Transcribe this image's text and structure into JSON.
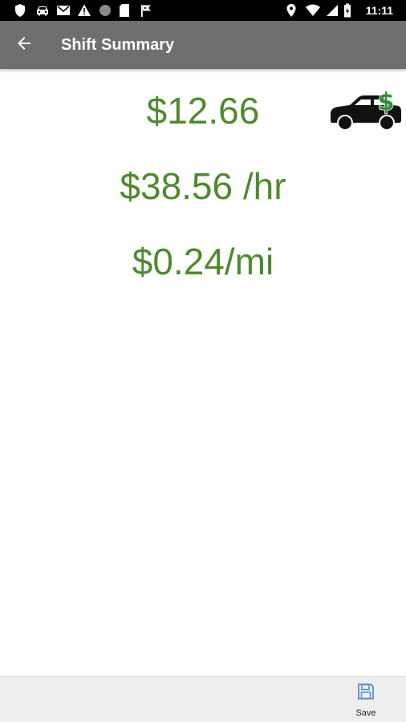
{
  "status_bar": {
    "time": "11:11",
    "left_icons": [
      "shield-icon",
      "car-icon",
      "gmail-icon",
      "warning-icon",
      "circle-icon",
      "sd-card-icon",
      "flag-icon"
    ],
    "right_icons": [
      "location-icon",
      "wifi-icon",
      "signal-icon",
      "battery-icon"
    ]
  },
  "app_bar": {
    "title": "Shift Summary",
    "back_icon": "arrow-back-icon",
    "background": "#6e6e6e"
  },
  "summary": {
    "total": "$12.66",
    "hourly": "$38.56 /hr",
    "per_mile": "$0.24/mi",
    "text_color": "#4e8a2e"
  },
  "bottom_bar": {
    "save_label": "Save",
    "save_icon": "floppy-disk-icon"
  }
}
